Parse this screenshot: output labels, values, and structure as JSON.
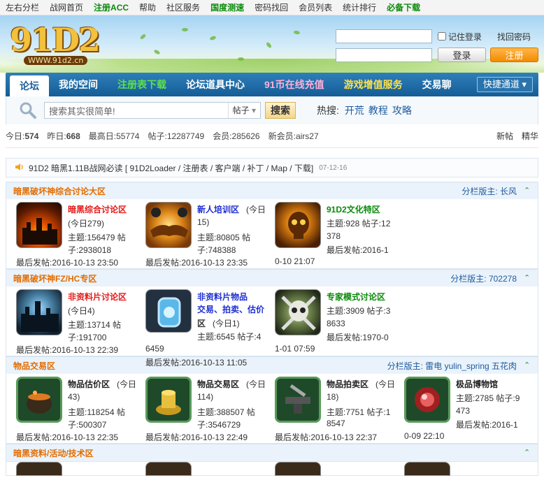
{
  "topnav": [
    "左右分栏",
    "战网首页",
    "注册ACC",
    "帮助",
    "社区服务",
    "国度测速",
    "密码找回",
    "会员列表",
    "统计排行",
    "必备下载"
  ],
  "logo": {
    "main": "91D2",
    "sub": "WWW.91d2.cn"
  },
  "login": {
    "remember": "记住登录",
    "findpw": "找回密码",
    "login_btn": "登录",
    "reg_btn": "注册"
  },
  "mainnav": {
    "items": [
      "论坛",
      "我的空间",
      "注册表下载",
      "论坛道具中心",
      "91币在线充值",
      "游戏增值服务",
      "交易聊"
    ],
    "quick": "快捷通道"
  },
  "search": {
    "placeholder": "搜索其实很简单!",
    "type": "帖子",
    "button": "搜索",
    "hot_label": "热搜:",
    "hot": [
      "开荒",
      "教程",
      "攻略"
    ]
  },
  "stats": {
    "today_label": "今日:",
    "today": "574",
    "yesterday_label": "昨日:",
    "yesterday": "668",
    "max_label": "最高日:",
    "max": "55774",
    "posts_label": "帖子:",
    "posts": "12287749",
    "members_label": "会员:",
    "members": "285626",
    "newmember_label": "新会员:",
    "newmember": "airs27",
    "newpost": "新帖",
    "digest": "精华"
  },
  "notice": {
    "text": "91D2 暗黑1.11B战网必读 [ 91D2Loader / 注册表 / 客户端 / 补丁 / Map / 下载]",
    "date": "07-12-16"
  },
  "sections": [
    {
      "title": "暗黑破坏神综合讨论大区",
      "mods": "分栏版主: 长风",
      "forums": [
        {
          "icon": "castle-icon",
          "name": "暗黑综合讨论区",
          "color": "red",
          "today": "(今日279)",
          "topics": "主题:156479 帖",
          "posts": "子:2938018",
          "last": "最后发帖:2016-10-13 23:50"
        },
        {
          "icon": "handshake-icon",
          "name": "新人培训区",
          "color": "blue",
          "today": "(今日",
          "today2": "15)",
          "topics": "主题:80805 帖",
          "posts": "子:748388",
          "last": "最后发帖:2016-10-13 23:35"
        },
        {
          "icon": "skull-icon",
          "name": "91D2文化特区",
          "color": "grn",
          "topics": "主题:928 帖子:12",
          "posts": "378",
          "last2": "最后发帖:2016-1",
          "last": "0-10 21:07"
        }
      ]
    },
    {
      "title": "暗黑破坏神FZ/HC专区",
      "mods": "分栏版主: 702278",
      "forums": [
        {
          "icon": "dark-castle-icon",
          "name": "非资料片讨论区",
          "color": "red",
          "today": "(今日4)",
          "topics": "主题:13714 帖",
          "posts": "子:191700",
          "last": "最后发帖:2016-10-13 22:39"
        },
        {
          "icon": "gem-amulet-icon",
          "name": "非资料片物品",
          "name2": "交易、拍卖、估价",
          "name3": "区",
          "color": "blue",
          "today": "(今日1)",
          "topics": "主题:6545 帖子:4",
          "posts": "6459",
          "last": "最后发帖:2016-10-13 11:05"
        },
        {
          "icon": "skull-crossbones-icon",
          "name": "专家模式讨论区",
          "color": "grn",
          "topics": "主题:3909 帖子:3",
          "posts": "8633",
          "last2": "最后发帖:1970-0",
          "last": "1-01 07:59"
        }
      ]
    },
    {
      "title": "物品交易区",
      "mods": "分栏版主: 雷电 yulin_spring 五花肉",
      "forums": [
        {
          "icon": "cauldron-icon",
          "name": "物品估价区",
          "color": "blk",
          "today": "(今日",
          "today2": "43)",
          "topics": "主题:118254 帖",
          "posts": "子:500307",
          "last": "最后发帖:2016-10-13 22:35"
        },
        {
          "icon": "gold-coins-icon",
          "name": "物品交易区",
          "color": "blk",
          "today": "(今日",
          "today2": "114)",
          "topics": "主题:388507 帖",
          "posts": "子:3546729",
          "last": "最后发帖:2016-10-13 22:49"
        },
        {
          "icon": "anvil-icon",
          "name": "物品拍卖区",
          "color": "blk",
          "today": "(今日",
          "today2": "18)",
          "topics": "主题:7751 帖子:1",
          "posts": "8547",
          "last": "最后发帖:2016-10-13 22:37"
        },
        {
          "icon": "orb-icon",
          "name": "极品博物馆",
          "color": "blk",
          "topics": "主题:2785 帖子:9",
          "posts": "473",
          "last2": "最后发帖:2016-1",
          "last": "0-09 22:10"
        }
      ]
    },
    {
      "title": "暗黑资料/活动/技术区",
      "mods": ""
    }
  ]
}
